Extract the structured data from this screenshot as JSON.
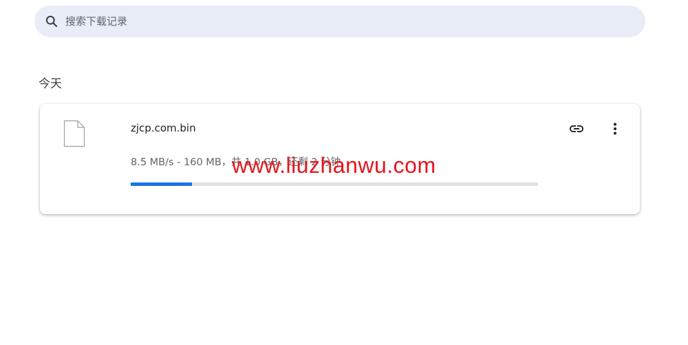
{
  "search": {
    "placeholder": "搜索下载记录",
    "icon": "search-icon"
  },
  "section": {
    "heading": "今天"
  },
  "download": {
    "file_name": "zjcp.com.bin",
    "file_icon": "file-icon",
    "status": "8.5 MB/s - 160 MB，共 1.0 GB，还剩 2 分钟",
    "progress_fraction": 0.15,
    "actions": {
      "copy_link_icon": "link-icon",
      "more_icon": "more-vert-icon"
    }
  },
  "watermark": "www.liuzhanwu.com",
  "colors": {
    "search_bg": "#e9edf7",
    "progress_fill": "#1a73e8",
    "progress_track": "#e0e0e0",
    "watermark": "#e8141b"
  }
}
